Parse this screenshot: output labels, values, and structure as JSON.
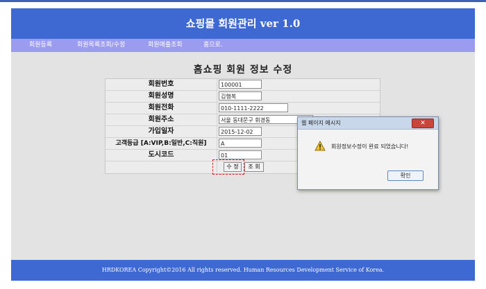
{
  "app": {
    "title": "쇼핑몰 회원관리 ver 1.0"
  },
  "nav": {
    "items": [
      "회원등록",
      "회원목록조회/수정",
      "회원매출조회",
      "홈으로."
    ]
  },
  "page": {
    "title": "홈쇼핑 회원 정보 수정"
  },
  "form": {
    "fields": [
      {
        "label": "회원번호",
        "value": "100001"
      },
      {
        "label": "회원성명",
        "value": "김행복"
      },
      {
        "label": "회원전화",
        "value": "010-1111-2222"
      },
      {
        "label": "회원주소",
        "value": "서울 동대문구 휘경동"
      },
      {
        "label": "가입일자",
        "value": "2015-12-02"
      },
      {
        "label": "고객등급 [A:VIP,B:일반,C:직원]",
        "value": "A"
      },
      {
        "label": "도시코드",
        "value": "01"
      }
    ],
    "buttons": {
      "update": "수 정",
      "view": "조 회"
    }
  },
  "dialog": {
    "title": "웹 페이지 메시지",
    "message": "회원정보수정이 완료 되었습니다!",
    "ok": "확인",
    "icon": "warning-icon"
  },
  "footer": {
    "text": "HRDKOREA Copyright©2016 All rights reserved. Human Resources Development Service of Korea."
  },
  "colors": {
    "header": "#3f69d2",
    "nav": "#9b9bf0",
    "highlight": "#d02020"
  }
}
